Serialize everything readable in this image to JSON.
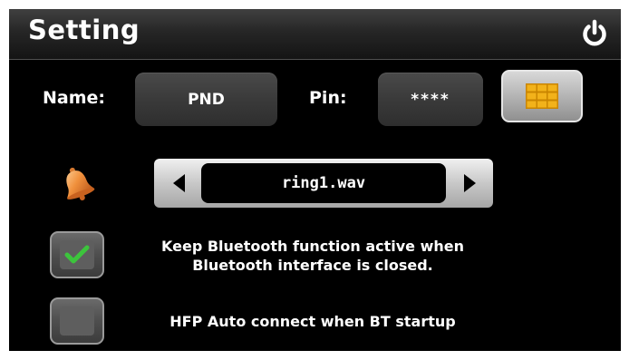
{
  "header": {
    "title": "Setting",
    "power_icon": "power-icon"
  },
  "device": {
    "name_label": "Name:",
    "name_value": "PND",
    "pin_label": "Pin:",
    "pin_value": "****",
    "keypad_icon": "keypad-grid-icon"
  },
  "ringtone": {
    "icon": "bell-icon",
    "value": "ring1.wav",
    "prev_icon": "arrow-left-icon",
    "next_icon": "arrow-right-icon"
  },
  "options": [
    {
      "line1": "Keep Bluetooth function active when",
      "line2": "Bluetooth interface is closed.",
      "checked": true
    },
    {
      "line1": "HFP Auto connect when BT startup",
      "checked": false
    }
  ],
  "colors": {
    "accent_keypad": "#f0a800",
    "checkmark": "#3cc43c",
    "bell": "#e8893a"
  }
}
